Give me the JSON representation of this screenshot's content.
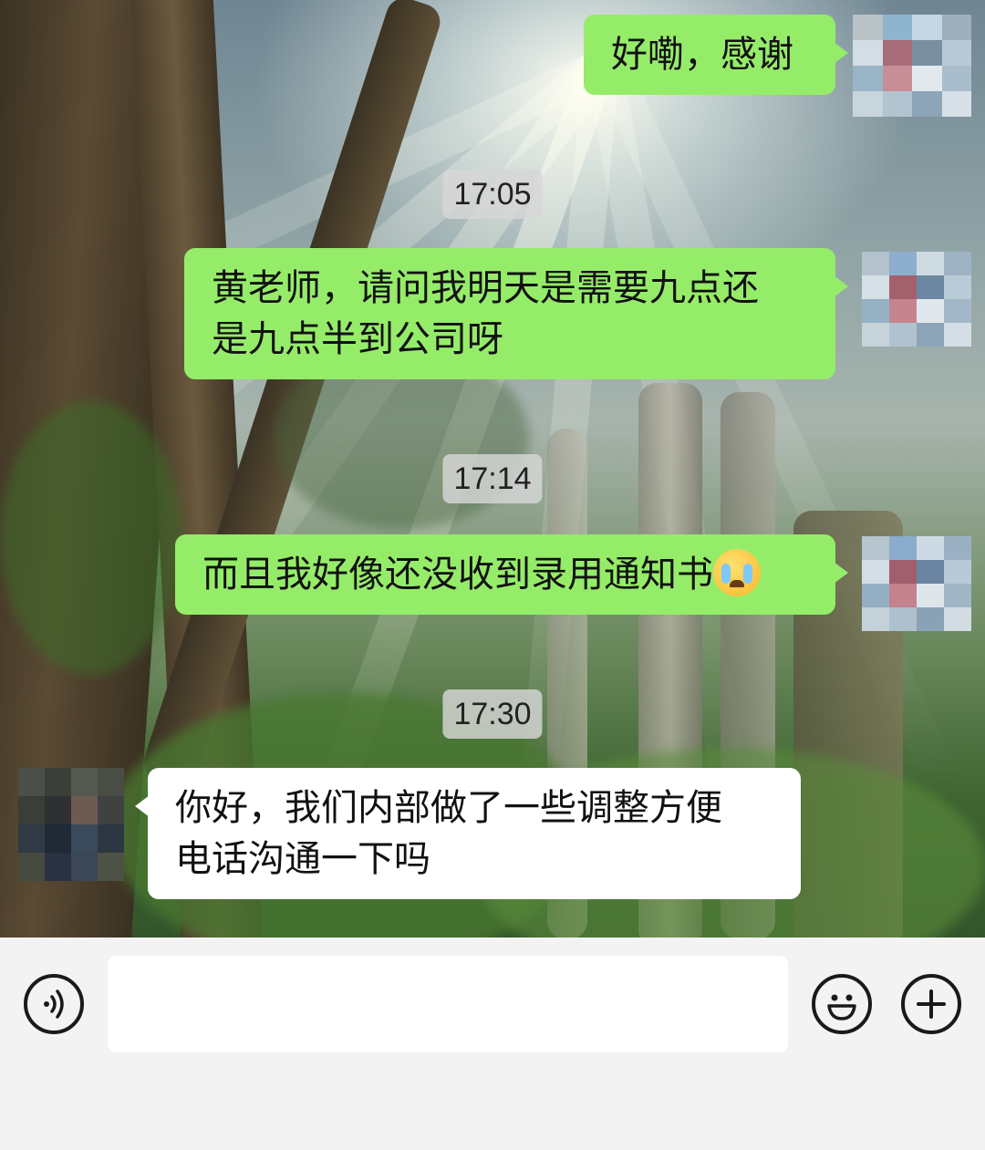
{
  "messages": [
    {
      "id": "m1",
      "side": "sent",
      "text": "好嘞，感谢"
    },
    {
      "id": "ts1",
      "type": "timestamp",
      "text": "17:05"
    },
    {
      "id": "m2",
      "side": "sent",
      "line1": "黄老师，请问我明天是需要九点还",
      "line2": "是九点半到公司呀"
    },
    {
      "id": "ts2",
      "type": "timestamp",
      "text": "17:14"
    },
    {
      "id": "m3",
      "side": "sent",
      "text": "而且我好像还没收到录用通知书",
      "emoji": "crying-face-emoji"
    },
    {
      "id": "ts3",
      "type": "timestamp",
      "text": "17:30"
    },
    {
      "id": "m4",
      "side": "received",
      "line1": "你好，我们内部做了一些调整方便",
      "line2": "电话沟通一下吗"
    }
  ],
  "input_bar": {
    "voice_icon": "voice-input-icon",
    "text_value": "",
    "emoji_icon": "emoji-smiley-icon",
    "plus_icon": "plus-icon"
  },
  "colors": {
    "sent_bubble": "#95ec69",
    "received_bubble": "#ffffff",
    "input_bar_bg": "#f3f3f3",
    "timestamp_bg": "#d7d7d7"
  }
}
